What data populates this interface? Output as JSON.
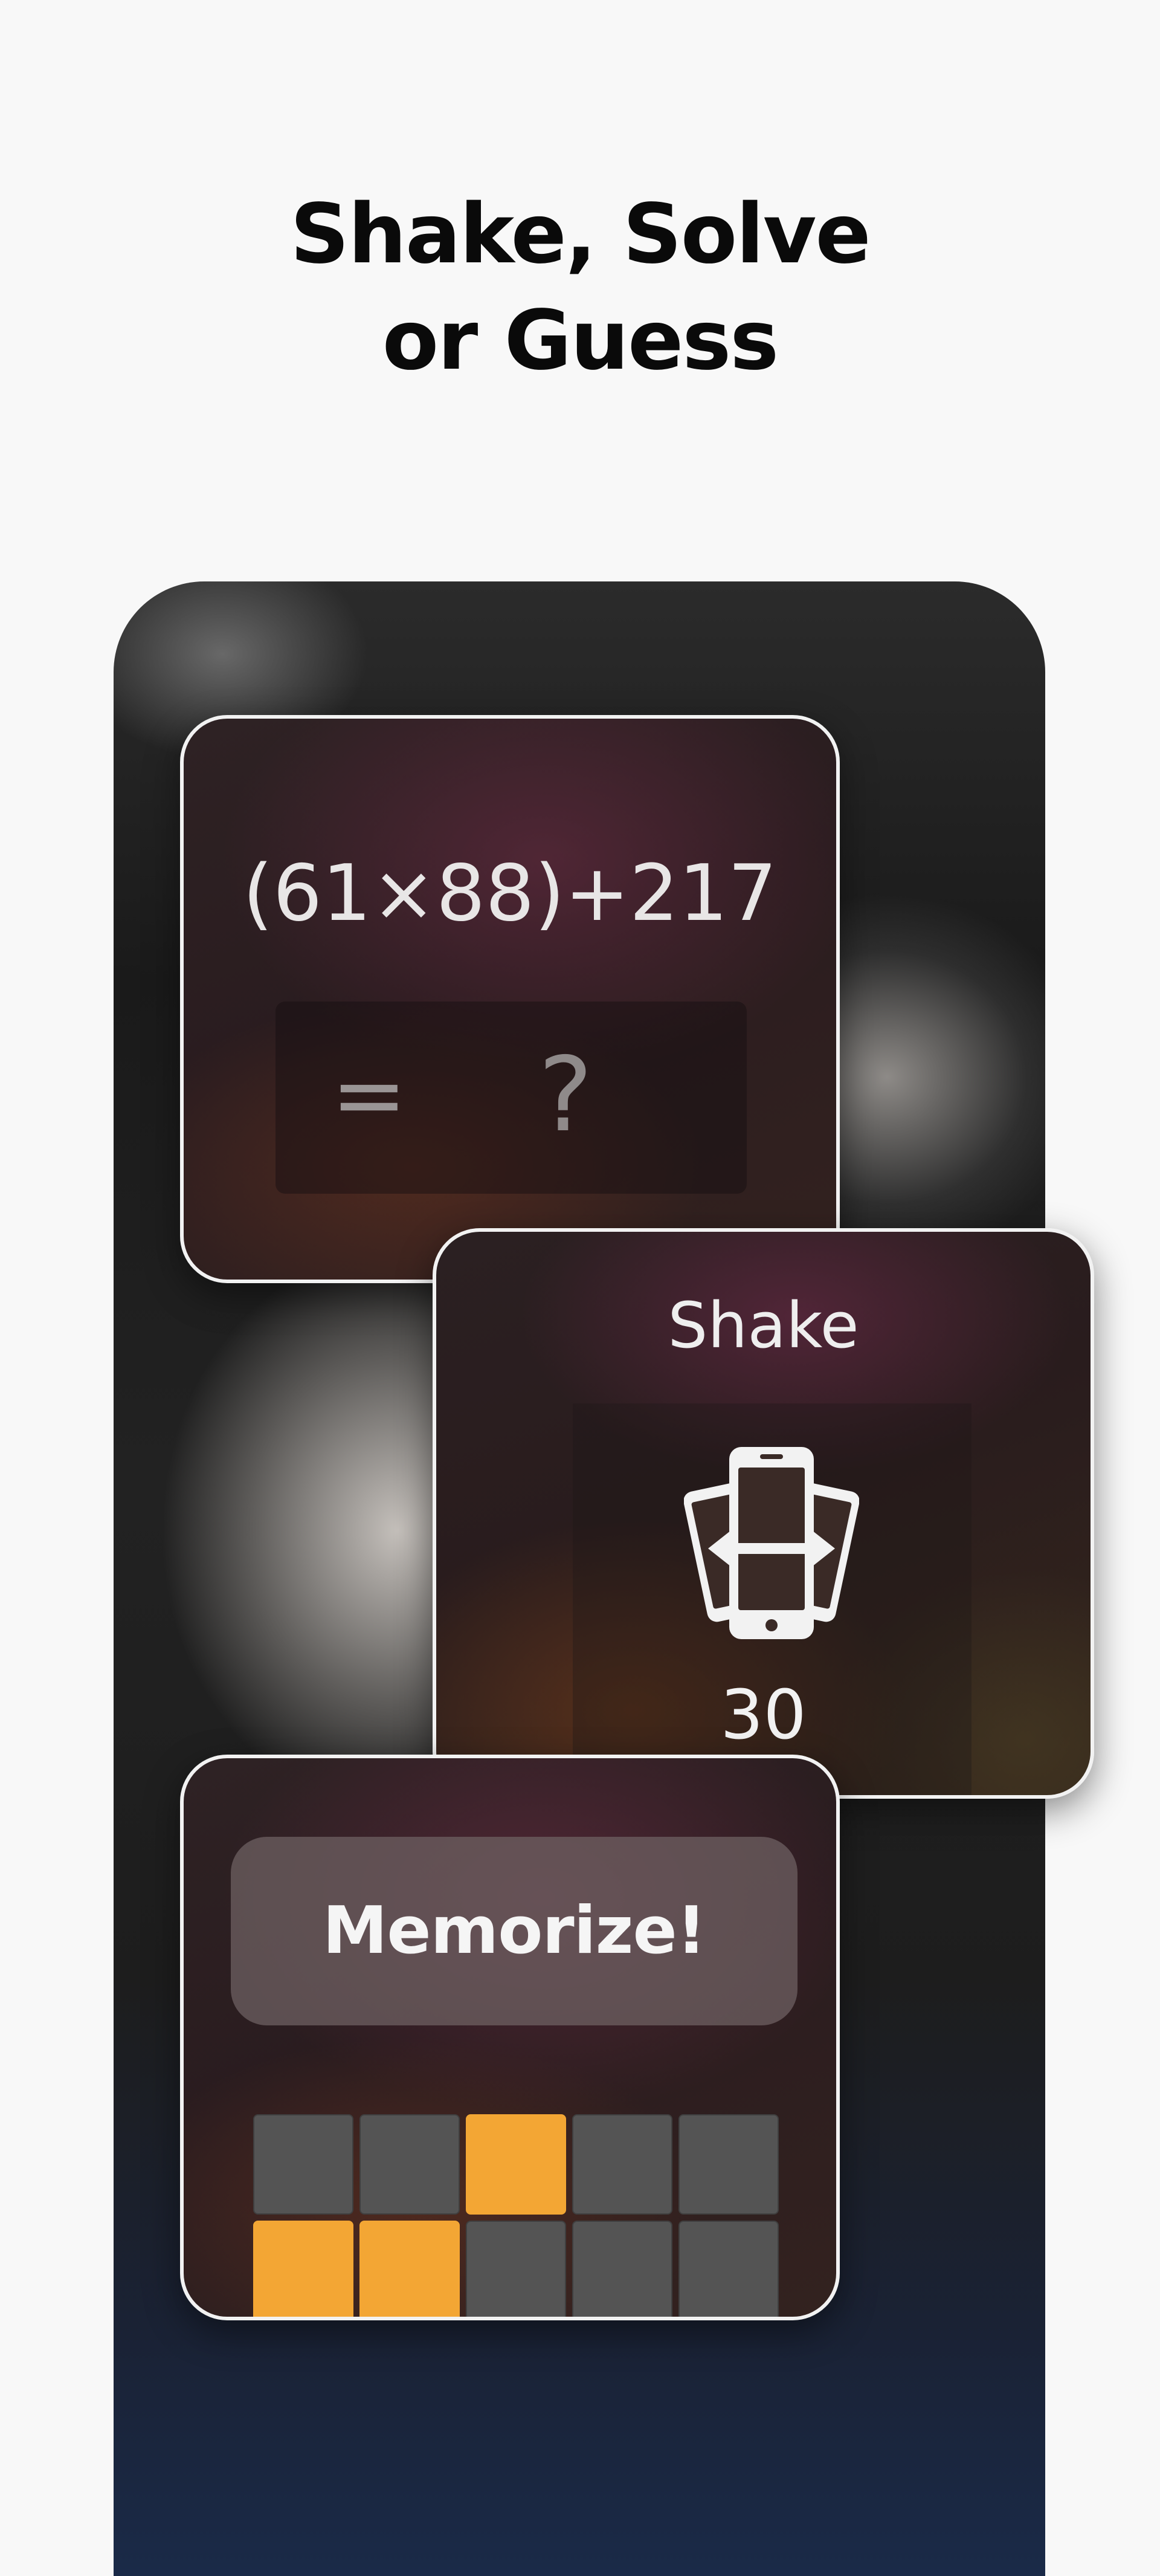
{
  "headline": {
    "line1": "Shake, Solve",
    "line2": "or Guess"
  },
  "math_card": {
    "equation": "(61×88)+217",
    "equals": "=",
    "answer_placeholder": "?"
  },
  "shake_card": {
    "title": "Shake",
    "icon": "phone-shake-icon",
    "count": "30"
  },
  "memory_card": {
    "button_label": "Memorize!",
    "tile_rows": [
      [
        false,
        false,
        true,
        false,
        false
      ],
      [
        true,
        true,
        false,
        false,
        false
      ]
    ],
    "colors": {
      "active": "#f3a634",
      "inactive": "#545454"
    }
  }
}
